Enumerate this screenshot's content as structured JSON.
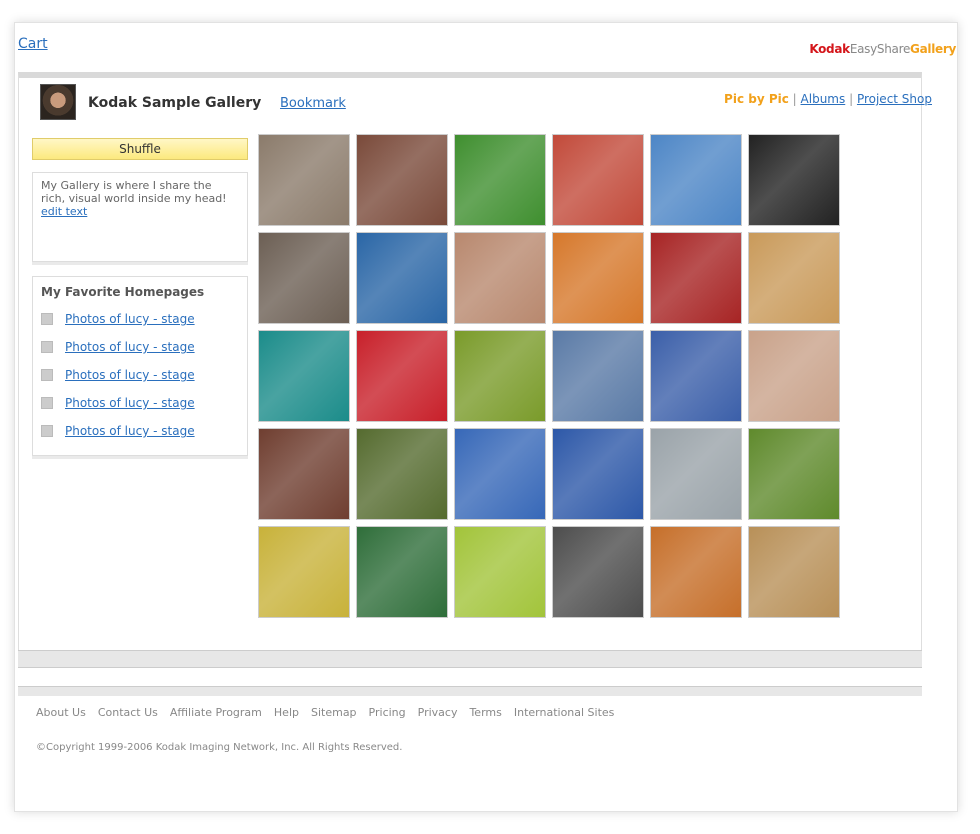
{
  "header": {
    "top_link": "Cart",
    "brand": {
      "kodak": "Kodak",
      "easyshare": "EasyShare",
      "gallery": "Gallery"
    }
  },
  "gallery": {
    "title": "Kodak Sample Gallery",
    "bookmark": "Bookmark",
    "views": {
      "active": "Pic by Pic",
      "albums": "Albums",
      "project": "Project Shop"
    }
  },
  "sidebar": {
    "shuffle": "Shuffle",
    "about_text": "My Gallery is where I share the rich, visual world inside my head!",
    "edit_text": "edit text",
    "favorites_title": "My Favorite Homepages",
    "favorites": [
      "Photos of lucy - stage",
      "Photos of lucy - stage",
      "Photos of lucy - stage",
      "Photos of lucy - stage",
      "Photos of lucy - stage"
    ]
  },
  "footer": {
    "links": [
      "About Us",
      "Contact Us",
      "Affiliate Program",
      "Help",
      "Sitemap",
      "Pricing",
      "Privacy",
      "Terms",
      "International Sites"
    ],
    "copyright": "©Copyright 1999-2006 Kodak Imaging Network, Inc. All Rights Reserved."
  },
  "photos": [
    {
      "name": "cats-photo",
      "c": "#8b7b6b"
    },
    {
      "name": "person-hallway-photo",
      "c": "#7a4a3a"
    },
    {
      "name": "red-flower-photo",
      "c": "#3f8f2f"
    },
    {
      "name": "people-helmet-photo",
      "c": "#c24a3a"
    },
    {
      "name": "woman-portrait-photo",
      "c": "#4d86c6"
    },
    {
      "name": "car-interior-photo",
      "c": "#222222"
    },
    {
      "name": "room-photo",
      "c": "#6c5f54"
    },
    {
      "name": "lake-photo",
      "c": "#2a66a6"
    },
    {
      "name": "woman-hands-photo",
      "c": "#b8886e"
    },
    {
      "name": "orange-sculpture-photo",
      "c": "#d6782b"
    },
    {
      "name": "red-car-photo",
      "c": "#a72424"
    },
    {
      "name": "machine-photo",
      "c": "#c99a5a"
    },
    {
      "name": "teal-light-photo",
      "c": "#1b8c8a"
    },
    {
      "name": "letter-u-photo",
      "c": "#c8202a"
    },
    {
      "name": "green-texture-photo",
      "c": "#7a9b2a"
    },
    {
      "name": "jeans-photo",
      "c": "#5a7aa6"
    },
    {
      "name": "tree-sky-photo",
      "c": "#3b5fa9"
    },
    {
      "name": "face-closeup-photo",
      "c": "#c9a28a"
    },
    {
      "name": "person-hallway-2-photo",
      "c": "#6f3e30"
    },
    {
      "name": "statue-photo",
      "c": "#556b2f"
    },
    {
      "name": "bearded-man-photo",
      "c": "#3768b8"
    },
    {
      "name": "tree-sky-2-photo",
      "c": "#2d58a8"
    },
    {
      "name": "grey-panel-photo",
      "c": "#9aa3a9"
    },
    {
      "name": "moss-photo",
      "c": "#5f8a2c"
    },
    {
      "name": "yellow-blue-photo",
      "c": "#c8b23a"
    },
    {
      "name": "dark-leaves-photo",
      "c": "#2f6e3a"
    },
    {
      "name": "green-sun-photo",
      "c": "#a2c43a"
    },
    {
      "name": "light-streak-photo",
      "c": "#4d4d4d"
    },
    {
      "name": "orange-sculpture-2-photo",
      "c": "#c66f2a"
    },
    {
      "name": "machine-2-photo",
      "c": "#b89058"
    }
  ]
}
